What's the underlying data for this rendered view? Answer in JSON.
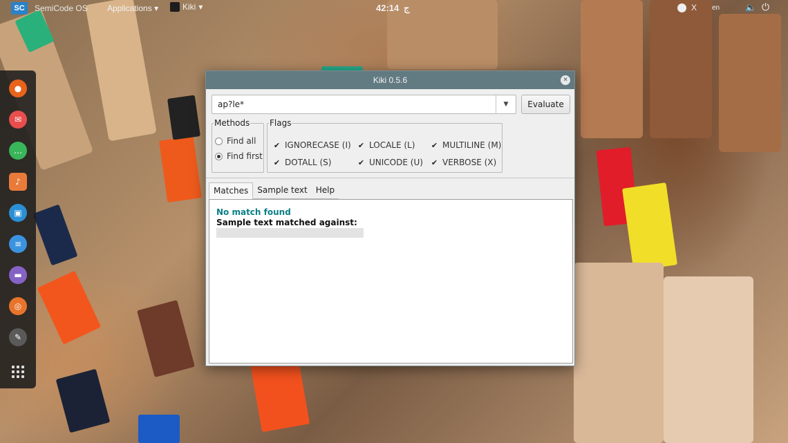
{
  "top_panel": {
    "logo": "SC",
    "os_name": "SemiCode OS",
    "applications_label": "Applications",
    "applications_arrow": "▾",
    "kiki_task_label": "Kiki",
    "kiki_task_arrow": "▾",
    "clock": "42:14",
    "clock_suffix": "ج",
    "tray_x": "X",
    "language": "en",
    "volume_icon": "volume-icon",
    "power_icon": "power-icon"
  },
  "dock": {
    "items": [
      "firefox-icon",
      "mail-icon",
      "chat-icon",
      "music-icon",
      "store-icon",
      "docs-icon",
      "files-icon",
      "help-icon",
      "gimp-icon"
    ],
    "grid_icon": "app-grid-icon"
  },
  "window": {
    "title": "Kiki 0.5.6",
    "close_glyph": "×",
    "regex_value": "ap?le*",
    "evaluate_label": "Evaluate",
    "methods": {
      "legend": "Methods",
      "find_all": "Find all",
      "find_first": "Find first",
      "selected": "find_first"
    },
    "flags": {
      "legend": "Flags",
      "ignorecase": "IGNORECASE (I)",
      "locale": "LOCALE (L)",
      "multiline": "MULTILINE (M)",
      "dotall": "DOTALL (S)",
      "unicode": "UNICODE (U)",
      "verbose": "VERBOSE (X)",
      "checked": true
    },
    "tabs": [
      "Matches",
      "Sample text",
      "Help"
    ],
    "active_tab": "Matches",
    "results": {
      "status": "No match found",
      "sample_label": "Sample text matched against:"
    }
  },
  "colors": {
    "titlebar": "#627a81",
    "status_text": "#0b7f86",
    "dock_bg": "#1e1e1e"
  }
}
